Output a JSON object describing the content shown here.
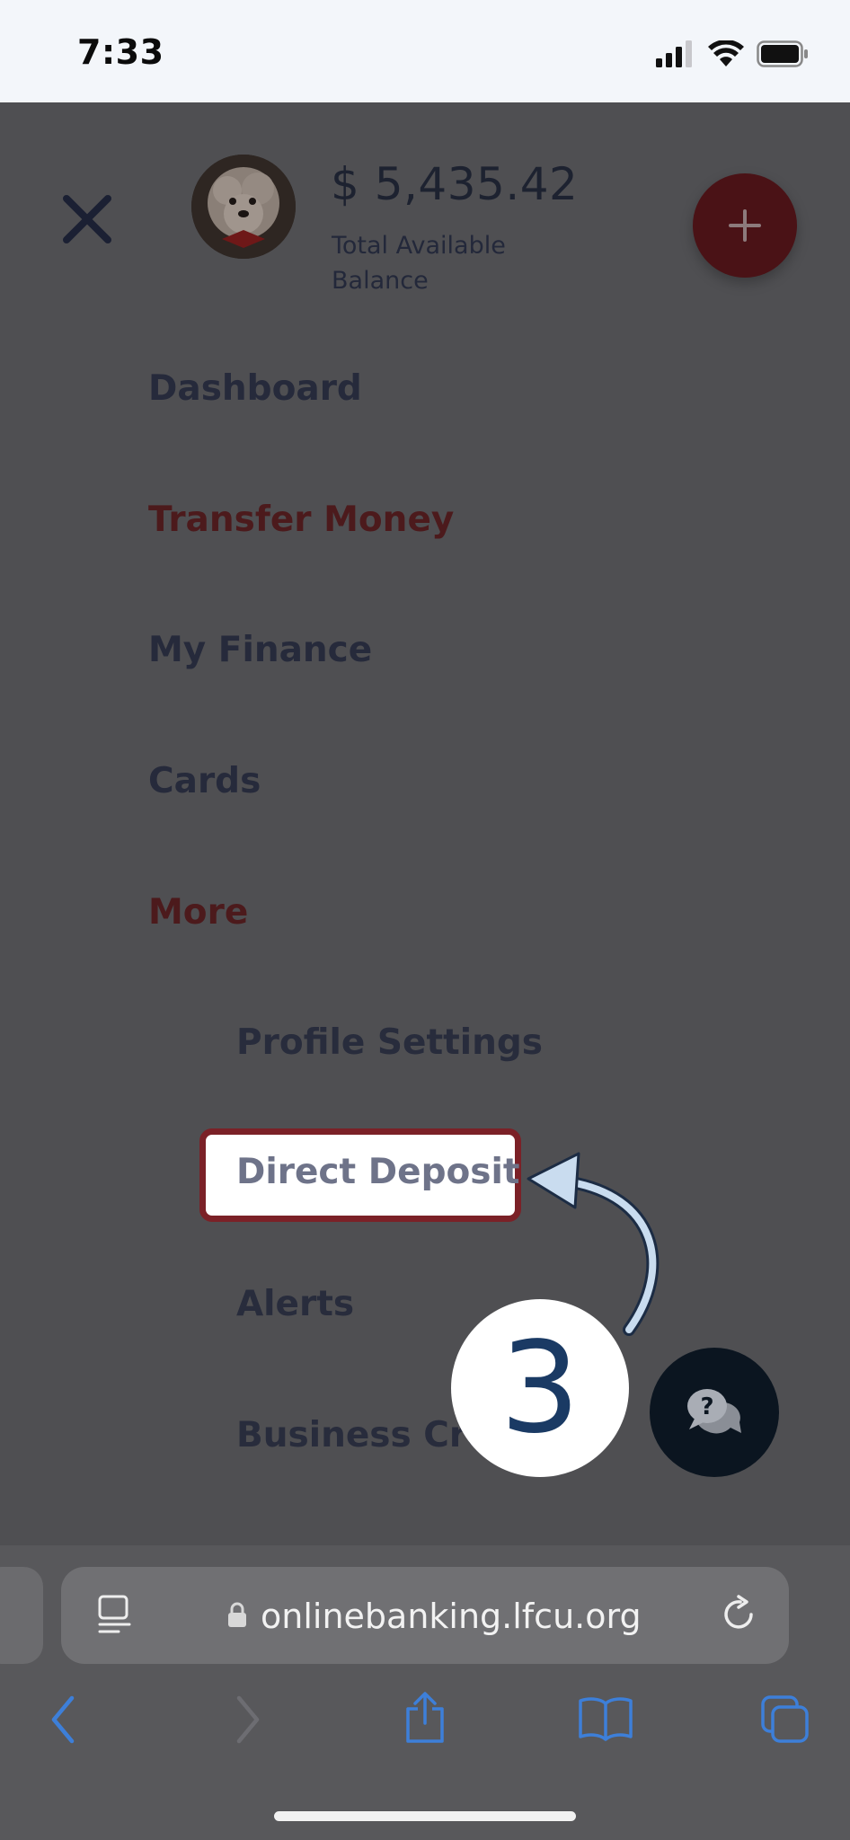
{
  "status_bar": {
    "time": "7:33",
    "icons": [
      "cellular-signal-icon",
      "wifi-icon",
      "battery-icon"
    ]
  },
  "header": {
    "close_icon": "close-icon",
    "balance": "$ 5,435.42",
    "balance_caption": "Total Available Balance",
    "add_icon": "plus-icon"
  },
  "menu": {
    "items": [
      {
        "label": "Dashboard"
      },
      {
        "label": "Transfer Money"
      },
      {
        "label": "My Finance"
      },
      {
        "label": "Cards"
      },
      {
        "label": "More"
      }
    ],
    "sub_items": [
      {
        "label": "Profile Settings"
      },
      {
        "label": "Direct Deposit"
      },
      {
        "label": "Alerts"
      },
      {
        "label": "Business Cre"
      }
    ]
  },
  "annotation": {
    "step": "3"
  },
  "browser": {
    "url": "onlinebanking.lfcu.org",
    "icons": [
      "reader-icon",
      "lock-icon",
      "reload-icon",
      "back-icon",
      "forward-icon",
      "share-icon",
      "bookmarks-icon",
      "tabs-icon"
    ]
  },
  "colors": {
    "accent_red": "#7b2127",
    "step_blue": "#1a3a64",
    "safari_blue": "#3d7fd9"
  }
}
